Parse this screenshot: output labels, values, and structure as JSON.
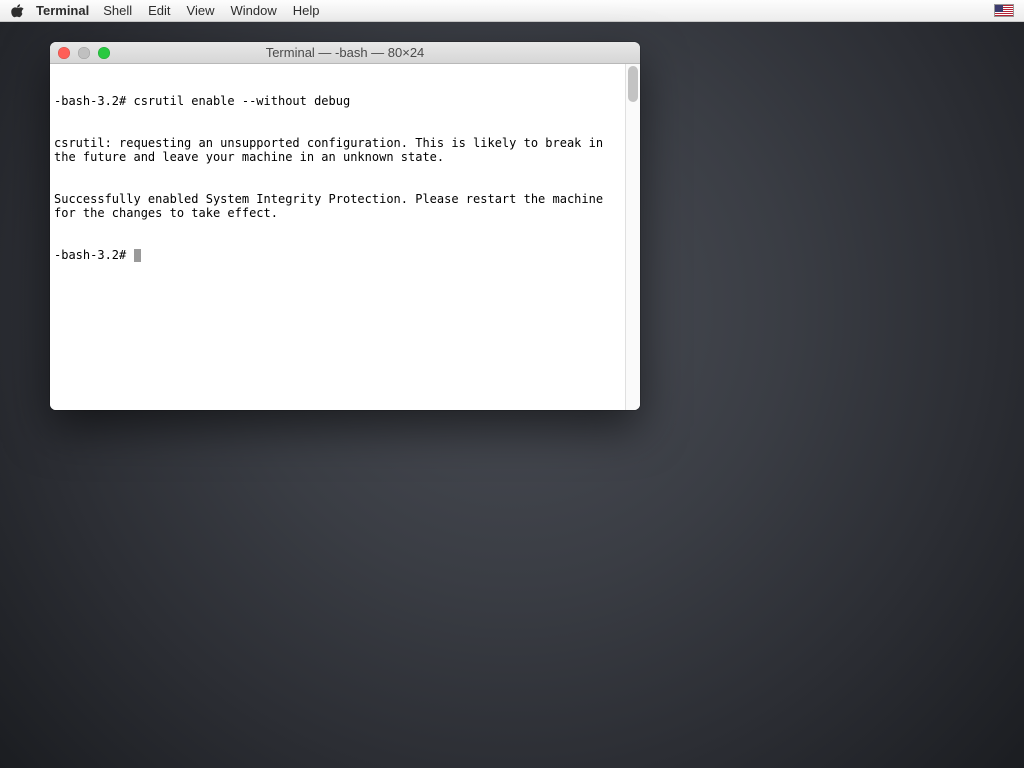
{
  "menubar": {
    "app": "Terminal",
    "items": [
      "Shell",
      "Edit",
      "View",
      "Window",
      "Help"
    ]
  },
  "window": {
    "title": "Terminal — -bash — 80×24"
  },
  "terminal": {
    "lines": [
      "-bash-3.2# csrutil enable --without debug",
      "csrutil: requesting an unsupported configuration. This is likely to break in the future and leave your machine in an unknown state.",
      "Successfully enabled System Integrity Protection. Please restart the machine for the changes to take effect.",
      "-bash-3.2# "
    ]
  }
}
